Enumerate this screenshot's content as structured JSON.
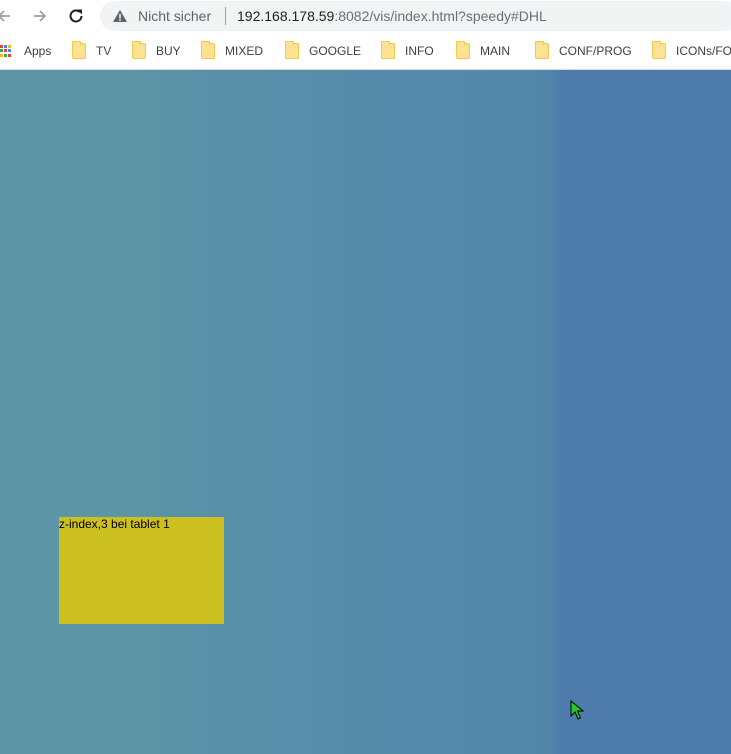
{
  "browser": {
    "security_label": "Nicht sicher",
    "url_host": "192.168.178.59",
    "url_path": ":8082/vis/index.html?speedy#DHL"
  },
  "bookmarks": {
    "apps_label": "Apps",
    "items": [
      {
        "label": "TV"
      },
      {
        "label": "BUY"
      },
      {
        "label": "MIXED"
      },
      {
        "label": "GOOGLE"
      },
      {
        "label": "INFO"
      },
      {
        "label": "MAIN"
      },
      {
        "label": "CONF/PROG"
      },
      {
        "label": "ICONs/FO"
      }
    ]
  },
  "page": {
    "box_text": "z-index,3 bei tablet 1",
    "box_color": "#cbc020"
  },
  "icons": {
    "back": "arrow-left-icon",
    "forward": "arrow-right-icon",
    "reload": "reload-icon",
    "warning": "warning-triangle-icon",
    "apps": "apps-grid-icon",
    "folder": "folder-icon",
    "cursor": "mouse-pointer-icon"
  }
}
